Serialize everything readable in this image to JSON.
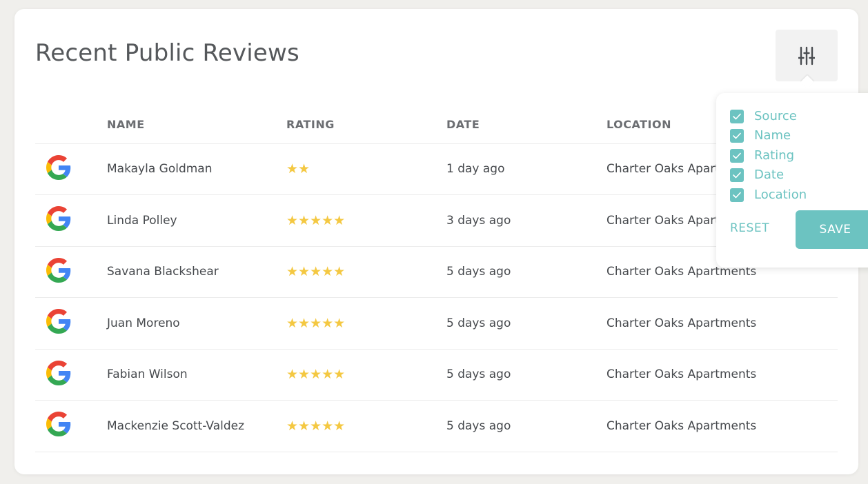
{
  "title": "Recent Public Reviews",
  "filter_button": {
    "icon": "sliders-icon"
  },
  "columns": [
    "NAME",
    "RATING",
    "DATE",
    "LOCATION"
  ],
  "rows": [
    {
      "source": "google",
      "name": "Makayla Goldman",
      "rating": 2,
      "stars": "★★",
      "date": "1 day ago",
      "location": "Charter Oaks Apartments"
    },
    {
      "source": "google",
      "name": "Linda Polley",
      "rating": 5,
      "stars": "★★★★★",
      "date": "3 days ago",
      "location": "Charter Oaks Apartments"
    },
    {
      "source": "google",
      "name": "Savana Blackshear",
      "rating": 5,
      "stars": "★★★★★",
      "date": "5 days ago",
      "location": "Charter Oaks Apartments"
    },
    {
      "source": "google",
      "name": "Juan Moreno",
      "rating": 5,
      "stars": "★★★★★",
      "date": "5 days ago",
      "location": "Charter Oaks Apartments"
    },
    {
      "source": "google",
      "name": "Fabian Wilson",
      "rating": 5,
      "stars": "★★★★★",
      "date": "5 days ago",
      "location": "Charter Oaks Apartments"
    },
    {
      "source": "google",
      "name": "Mackenzie Scott-Valdez",
      "rating": 5,
      "stars": "★★★★★",
      "date": "5 days ago",
      "location": "Charter Oaks Apartments"
    }
  ],
  "column_filter": {
    "options": [
      {
        "label": "Source",
        "checked": true
      },
      {
        "label": "Name",
        "checked": true
      },
      {
        "label": "Rating",
        "checked": true
      },
      {
        "label": "Date",
        "checked": true
      },
      {
        "label": "Location",
        "checked": true
      }
    ],
    "reset_label": "RESET",
    "save_label": "SAVE"
  },
  "colors": {
    "accent": "#6cc3c1",
    "star": "#f4c842"
  }
}
